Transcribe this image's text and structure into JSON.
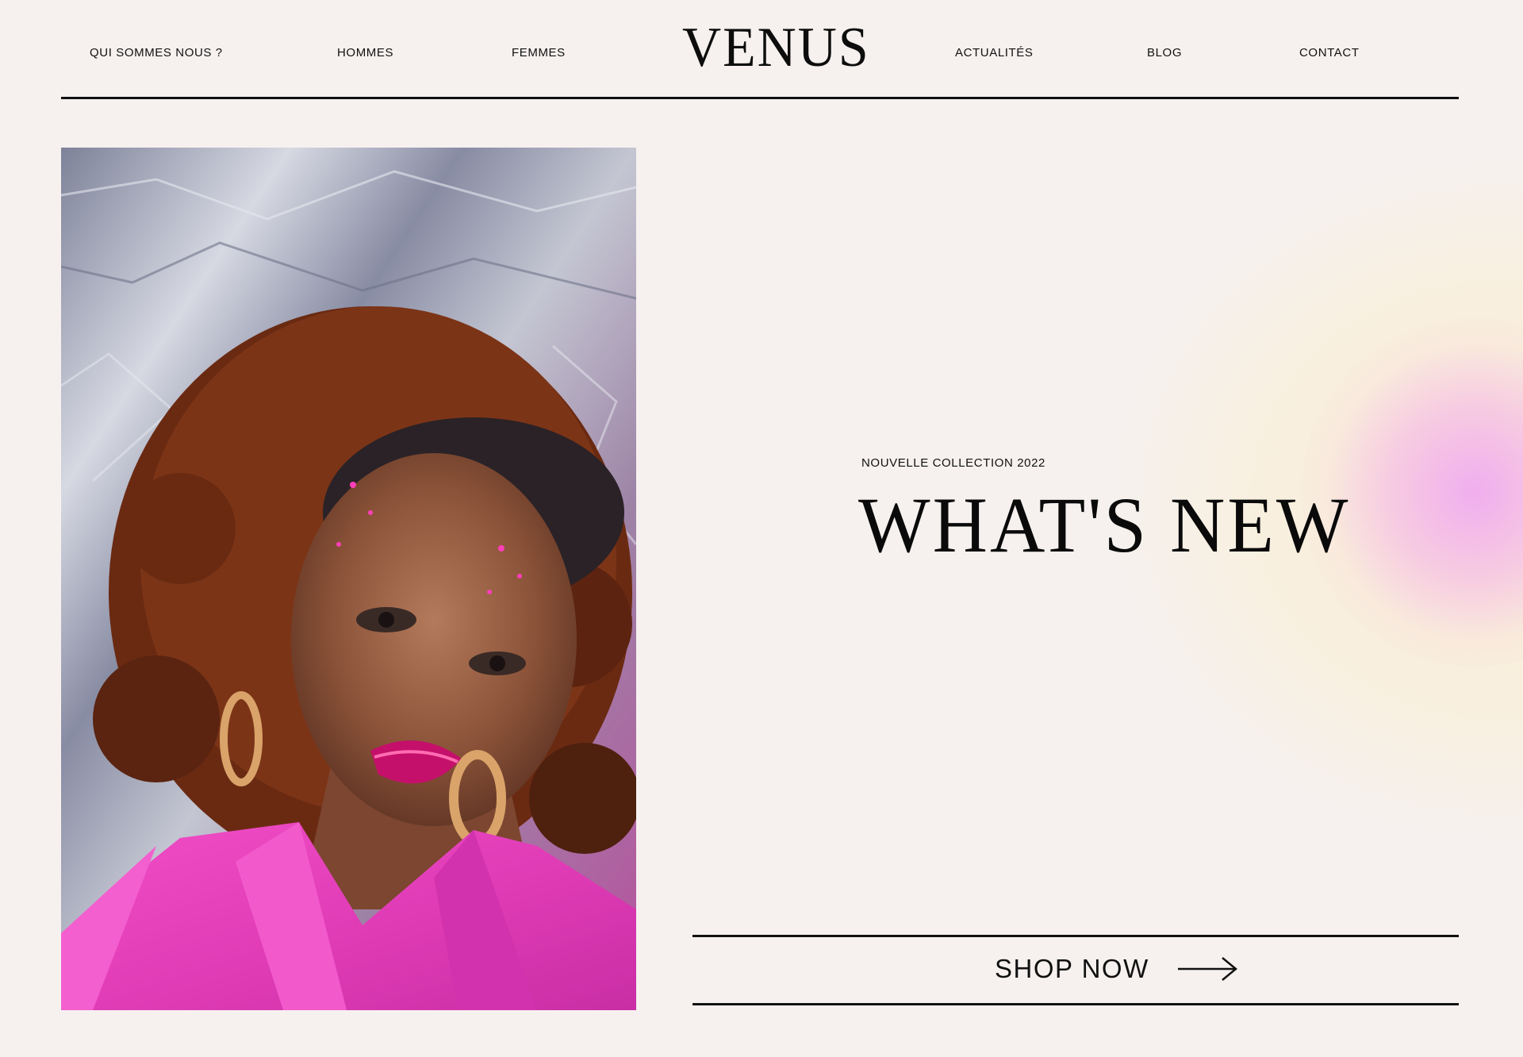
{
  "nav": {
    "items": [
      {
        "label": "QUI SOMMES NOUS ?"
      },
      {
        "label": "HOMMES"
      },
      {
        "label": "FEMMES"
      },
      {
        "label": "ACTUALITÉS"
      },
      {
        "label": "BLOG"
      },
      {
        "label": "CONTACT"
      }
    ],
    "logo": "VENUS"
  },
  "hero": {
    "eyebrow": "NOUVELLE COLLECTION 2022",
    "headline": "WHAT'S NEW",
    "image_icon": "model-portrait-photo"
  },
  "cta": {
    "label": "SHOP NOW",
    "icon": "arrow-right-icon"
  },
  "colors": {
    "background": "#f6f1ef",
    "text": "#111111",
    "accent_pink": "#e83fb8",
    "glow_yellow": "#faeed2",
    "glow_pink": "#f0aaf0"
  }
}
